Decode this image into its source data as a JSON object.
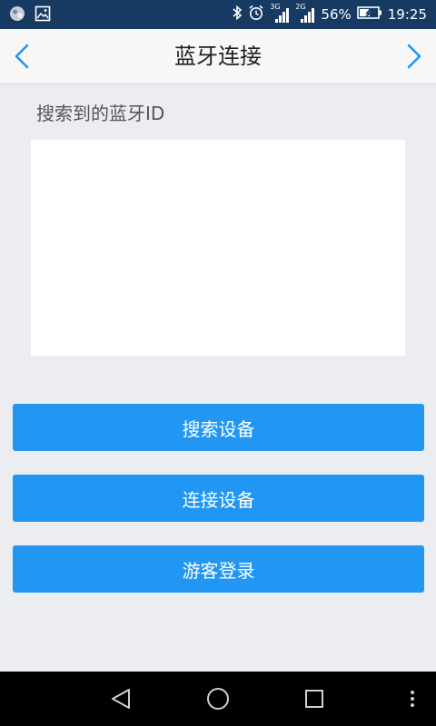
{
  "status_bar": {
    "net1_label": "3G",
    "net2_label": "2G",
    "battery": "56%",
    "time": "19:25"
  },
  "header": {
    "title": "蓝牙连接"
  },
  "main": {
    "section_label": "搜索到的蓝牙ID",
    "buttons": {
      "search": "搜索设备",
      "connect": "连接设备",
      "guest": "游客登录"
    }
  },
  "colors": {
    "status_bar_bg": "#173a63",
    "accent": "#2196f3",
    "page_bg": "#ebedf0"
  }
}
